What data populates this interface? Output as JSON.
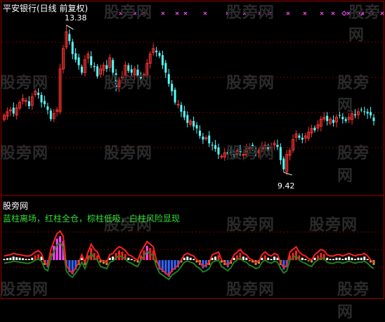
{
  "main_panel": {
    "title": "平安银行(日线 前复权)",
    "high_label": "13.38",
    "low_label": "9.42"
  },
  "indicator_panel": {
    "title": "股旁网",
    "legend": "蓝柱离场，红柱全仓，棕柱低吸，白柱风险显现"
  },
  "watermark_text": "股旁网",
  "colors": {
    "background": "#000000",
    "up_candle": "#ff3333",
    "down_candle": "#54ffff",
    "signal_mark": "#ff44ff",
    "legend_text": "#33dd33",
    "red_bar": "#ff2222",
    "blue_bar": "#3366ff",
    "brown_bar": "#c8a040",
    "white_bar": "#ffffff",
    "magenta_bar": "#ff44ff",
    "green_curve": "#1f7f1f",
    "red_curve": "#ff2020"
  },
  "chart_data": [
    {
      "type": "candlestick",
      "title": "平安银行(日线 前复权)",
      "xlabel": "",
      "ylabel": "",
      "annotations": [
        {
          "text": "13.38",
          "kind": "max"
        },
        {
          "text": "9.42",
          "kind": "min"
        }
      ],
      "ylim": [
        9.1,
        13.6
      ],
      "close": [
        10.95,
        11.05,
        11.1,
        11.0,
        11.15,
        11.3,
        11.4,
        11.35,
        11.2,
        11.45,
        11.6,
        11.5,
        11.3,
        11.25,
        11.1,
        10.85,
        11.0,
        11.1,
        12.2,
        12.75,
        13.2,
        12.95,
        12.6,
        12.45,
        12.3,
        12.1,
        12.45,
        12.6,
        12.3,
        12.25,
        12.0,
        12.2,
        12.3,
        12.2,
        12.5,
        12.1,
        11.7,
        11.9,
        12.0,
        12.3,
        12.15,
        12.1,
        12.2,
        12.0,
        11.95,
        12.05,
        12.35,
        12.6,
        12.75,
        12.65,
        12.55,
        12.3,
        12.1,
        11.8,
        11.6,
        11.3,
        11.25,
        11.05,
        10.9,
        10.75,
        10.8,
        10.65,
        10.6,
        10.4,
        10.3,
        10.35,
        10.2,
        10.15,
        10.05,
        9.9,
        9.85,
        9.95,
        9.9,
        9.95,
        9.9,
        10.0,
        9.95,
        9.9,
        10.05,
        10.1,
        10.05,
        9.95,
        10.0,
        10.1,
        10.15,
        10.05,
        10.1,
        10.2,
        10.1,
        9.75,
        9.5,
        9.9,
        10.0,
        10.3,
        10.45,
        10.35,
        10.3,
        10.4,
        10.5,
        10.6,
        10.55,
        10.7,
        10.85,
        10.9,
        10.8,
        10.85,
        10.75,
        10.9,
        10.95,
        10.85,
        10.8,
        10.9,
        11.0,
        10.95,
        11.05,
        11.1,
        11.05,
        11.0,
        10.95,
        10.8
      ],
      "signal_marks": "top row of magenta x and diamond markers"
    },
    {
      "type": "bar",
      "title": "股旁网",
      "legend": [
        "蓝柱离场",
        "红柱全仓",
        "棕柱低吸",
        "白柱风险显现"
      ],
      "ylim": [
        -1,
        1
      ],
      "values": [
        0.05,
        0.08,
        0.1,
        0.15,
        0.12,
        0.1,
        0.08,
        0.05,
        0.05,
        0.1,
        0.2,
        0.25,
        0.15,
        -0.2,
        -0.3,
        0.3,
        0.6,
        0.9,
        1.0,
        0.8,
        -0.3,
        -0.5,
        -0.6,
        -0.4,
        -0.2,
        0.1,
        -0.2,
        0.2,
        0.5,
        0.3,
        0.2,
        -0.1,
        -0.15,
        -0.2,
        0.1,
        0.15,
        0.3,
        0.4,
        0.35,
        0.25,
        0.1,
        0.05,
        -0.05,
        -0.1,
        0.2,
        0.4,
        0.6,
        0.5,
        0.4,
        -0.1,
        -0.4,
        -0.5,
        -0.6,
        -0.7,
        -0.5,
        -0.4,
        -0.3,
        -0.1,
        0.1,
        0.15,
        0.1,
        0.05,
        -0.1,
        -0.2,
        -0.35,
        -0.3,
        -0.2,
        0.1,
        0.15,
        0.2,
        -0.1,
        -0.2,
        -0.3,
        -0.15,
        0.1,
        0.2,
        0.3,
        0.15,
        0.1,
        -0.05,
        -0.1,
        -0.2,
        -0.15,
        0.1,
        0.2,
        0.1,
        0.05,
        0.15,
        0.1,
        -0.2,
        -0.4,
        -0.3,
        0.2,
        0.3,
        0.4,
        0.2,
        0.1,
        0.05,
        -0.05,
        -0.1,
        0.1,
        0.2,
        0.3,
        0.25,
        0.1,
        0.05,
        0.05,
        0.1,
        0.1,
        0.05,
        0.1,
        0.15,
        0.1,
        0.05,
        0.1,
        0.1,
        0.15,
        0.05,
        -0.1,
        -0.2
      ]
    }
  ]
}
